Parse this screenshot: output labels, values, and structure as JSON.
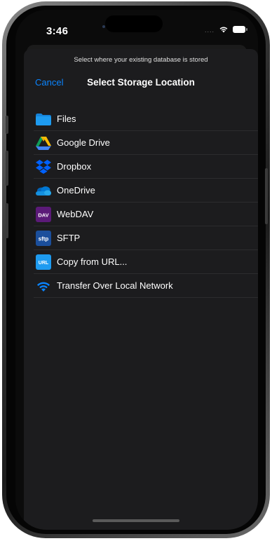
{
  "status_bar": {
    "time": "3:46",
    "signal_dots": "....",
    "icons": [
      "wifi-icon",
      "battery-icon"
    ]
  },
  "sheet": {
    "prompt": "Select where your existing database is stored",
    "cancel_label": "Cancel",
    "title": "Select Storage Location"
  },
  "storage_options": [
    {
      "label": "Files",
      "icon": "folder-icon",
      "color": "#1e9bf0"
    },
    {
      "label": "Google Drive",
      "icon": "google-drive-icon",
      "color": "#fbbc04"
    },
    {
      "label": "Dropbox",
      "icon": "dropbox-icon",
      "color": "#0061fe"
    },
    {
      "label": "OneDrive",
      "icon": "onedrive-icon",
      "color": "#0364b8"
    },
    {
      "label": "WebDAV",
      "icon": "webdav-icon",
      "icon_text": "DAV",
      "color": "#5b1a78"
    },
    {
      "label": "SFTP",
      "icon": "sftp-icon",
      "icon_text": "sftp",
      "color": "#1b4f9c"
    },
    {
      "label": "Copy from URL...",
      "icon": "url-icon",
      "icon_text": "URL",
      "color": "#1e9bf0"
    },
    {
      "label": "Transfer Over Local Network",
      "icon": "wifi-icon",
      "color": "#0a84ff"
    }
  ],
  "colors": {
    "accent": "#0a84ff",
    "sheet_background": "#1c1c1e",
    "separator": "#2c2c2e"
  }
}
